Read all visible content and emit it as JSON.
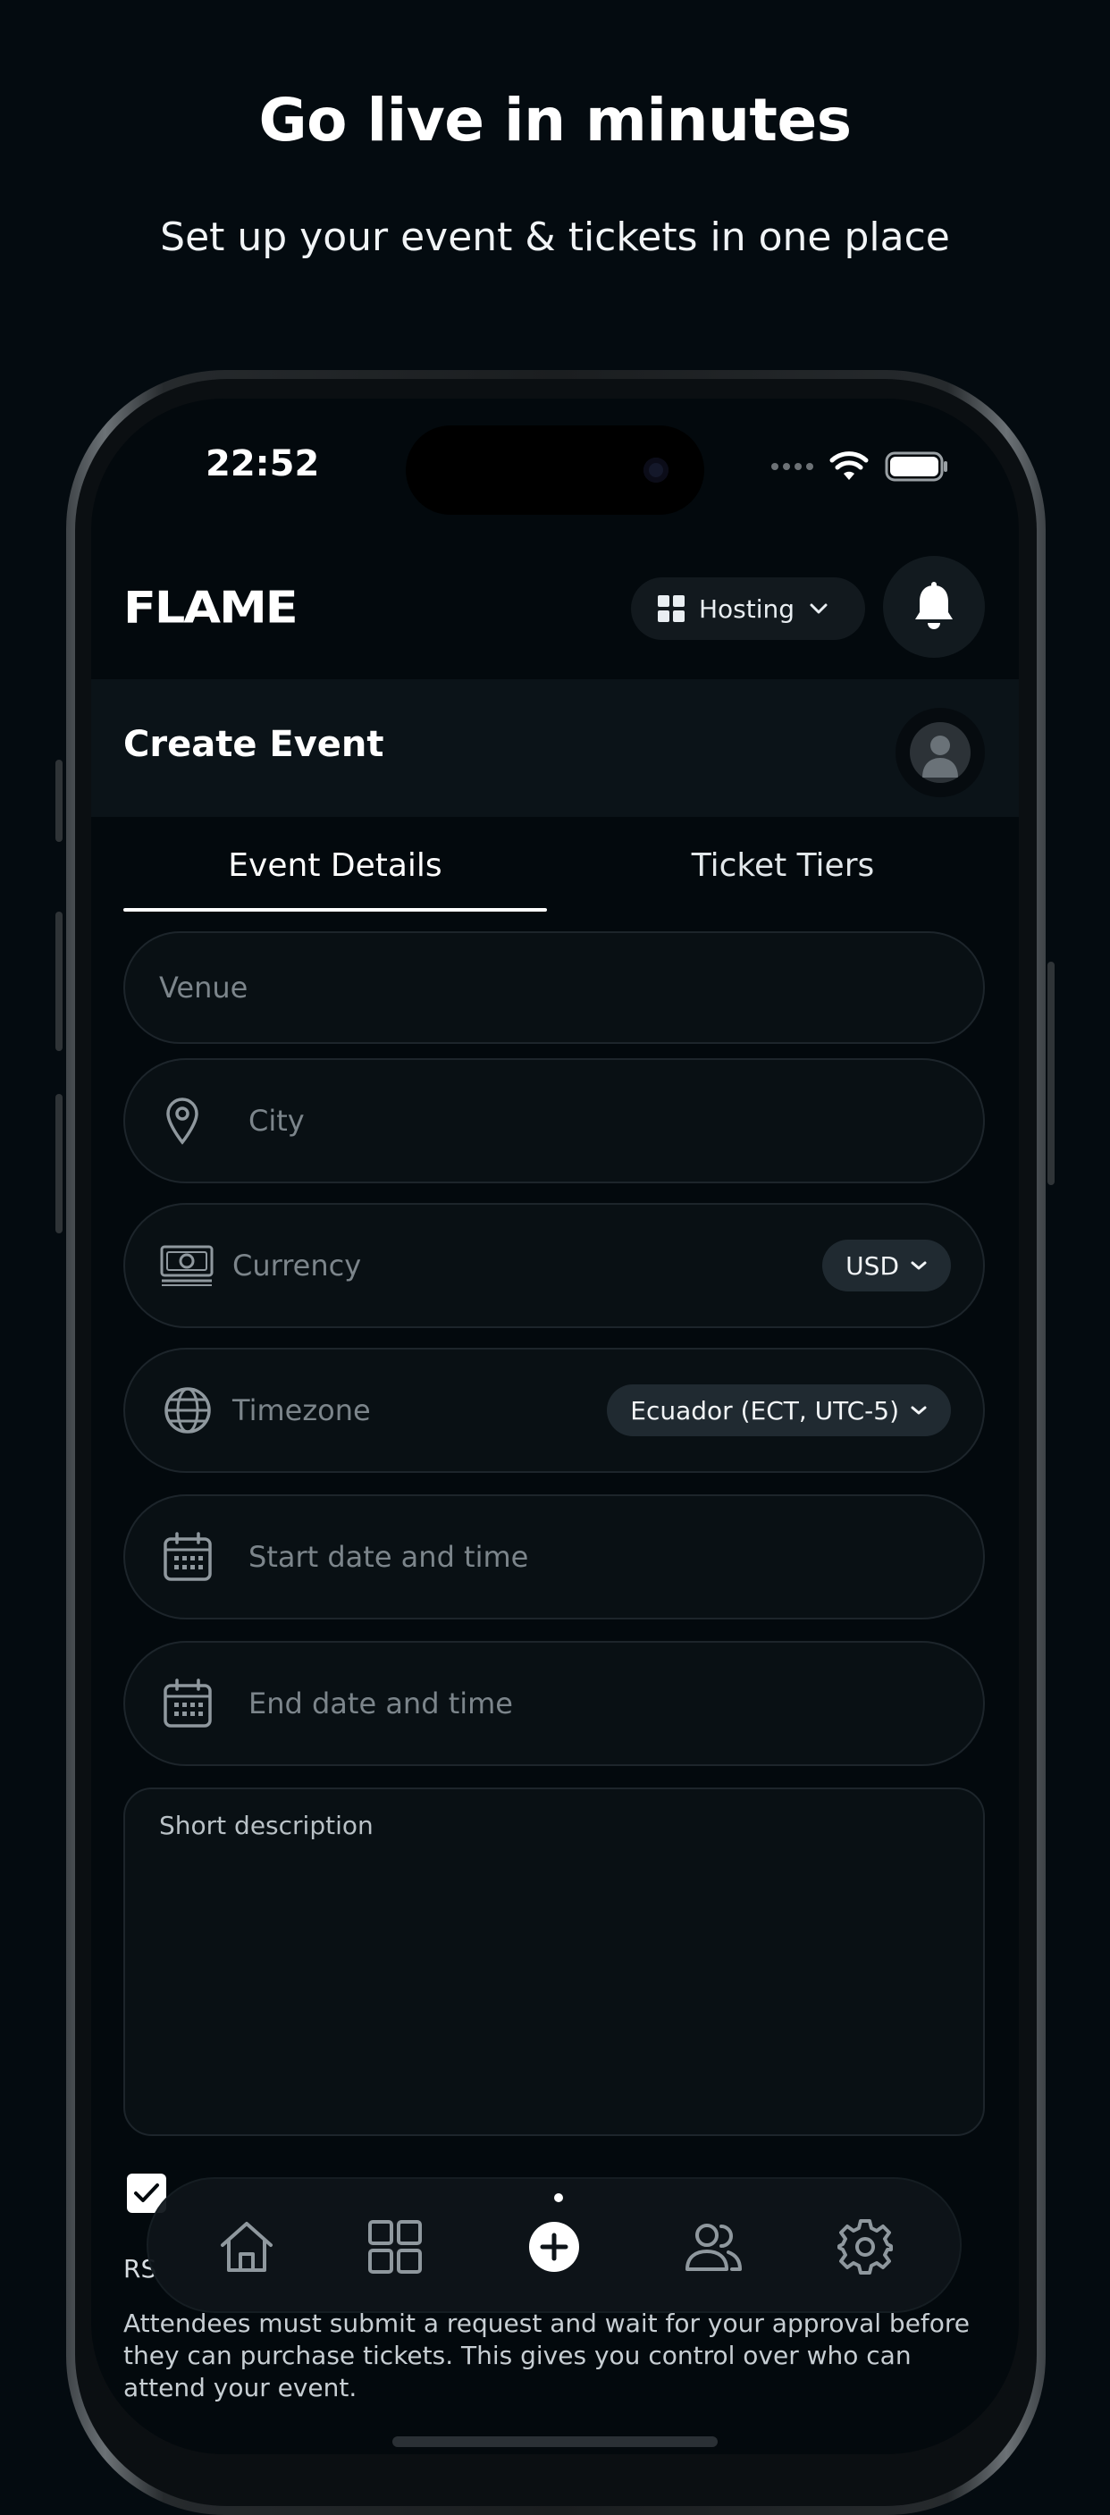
{
  "promo": {
    "headline": "Go live in minutes",
    "subheadline": "Set up your event & tickets in one place"
  },
  "status_bar": {
    "time": "22:52",
    "icons": [
      "cellular-icon",
      "wifi-icon",
      "battery-icon"
    ]
  },
  "app_header": {
    "logo_text": "FLAME",
    "mode_selector": {
      "label": "Hosting",
      "icon": "grid-icon"
    },
    "notification_icon": "bell-icon"
  },
  "page": {
    "title": "Create Event"
  },
  "tabs": [
    {
      "label": "Event Details",
      "active": true
    },
    {
      "label": "Ticket Tiers",
      "active": false
    }
  ],
  "form": {
    "venue_placeholder": "Venue",
    "city_placeholder": "City",
    "currency_placeholder": "Currency",
    "currency_value": "USD",
    "timezone_placeholder": "Timezone",
    "timezone_value": "Ecuador (ECT, UTC-5)",
    "start_placeholder": "Start date and time",
    "end_placeholder": "End date and time",
    "description_placeholder": "Short description"
  },
  "rsvp": {
    "checked": true,
    "label": "RS",
    "description": "Attendees must submit a request and wait for your approval before they can purchase tickets. This gives you control over who can attend your event."
  },
  "bottom_nav": [
    {
      "name": "home",
      "icon": "home-icon"
    },
    {
      "name": "dashboard",
      "icon": "grid-icon"
    },
    {
      "name": "create",
      "icon": "plus-circle-icon",
      "active": true
    },
    {
      "name": "community",
      "icon": "people-icon"
    },
    {
      "name": "settings",
      "icon": "gear-icon"
    }
  ],
  "colors": {
    "background": "#040b10",
    "screen": "#03090d",
    "field_border": "#1d252b",
    "placeholder": "#7c858b",
    "accent": "#ffffff"
  }
}
